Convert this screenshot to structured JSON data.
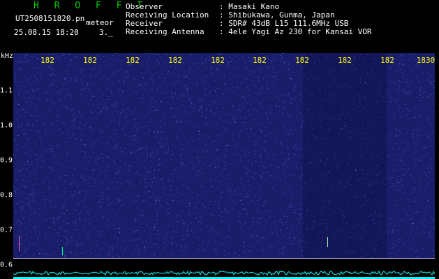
{
  "header": {
    "app_name": "H R O F F T",
    "filename": "UT2508151820.pn",
    "meteor_label": "meteor",
    "datetime": "25.08.15 18:20",
    "speed": "3._",
    "info": [
      {
        "label": "Observer",
        "value": ": Masaki Kano"
      },
      {
        "label": "Receiving Location",
        "value": ": Shibukawa, Gunma, Japan"
      },
      {
        "label": "Receiver",
        "value": ": SDR# 43dB L15 111.6MHz USB"
      },
      {
        "label": "Receiving Antenna",
        "value": ": 4ele Yagi Az 230 for Kansai VOR"
      }
    ]
  },
  "axes": {
    "y_unit": "kHz",
    "x_ticks": [
      "182",
      "182",
      "182",
      "182",
      "182",
      "182",
      "182",
      "182",
      "182",
      "1830"
    ],
    "y_ticks": [
      "1.1",
      "1.0",
      "0.9",
      "0.8",
      "0.7",
      "0.6"
    ]
  },
  "colors": {
    "brand": "#00cc00",
    "text": "#ffffff",
    "tick_x": "#ffff00",
    "tick_y": "#ffffff",
    "waterfall_bg": "#1a1e6a",
    "waterfall_dot": "#4a55d8",
    "spectrum": "#00ffff",
    "marker_green": "#00ff88",
    "marker_yellow": "#ffff00",
    "ref_line": "#9a9ab8"
  }
}
